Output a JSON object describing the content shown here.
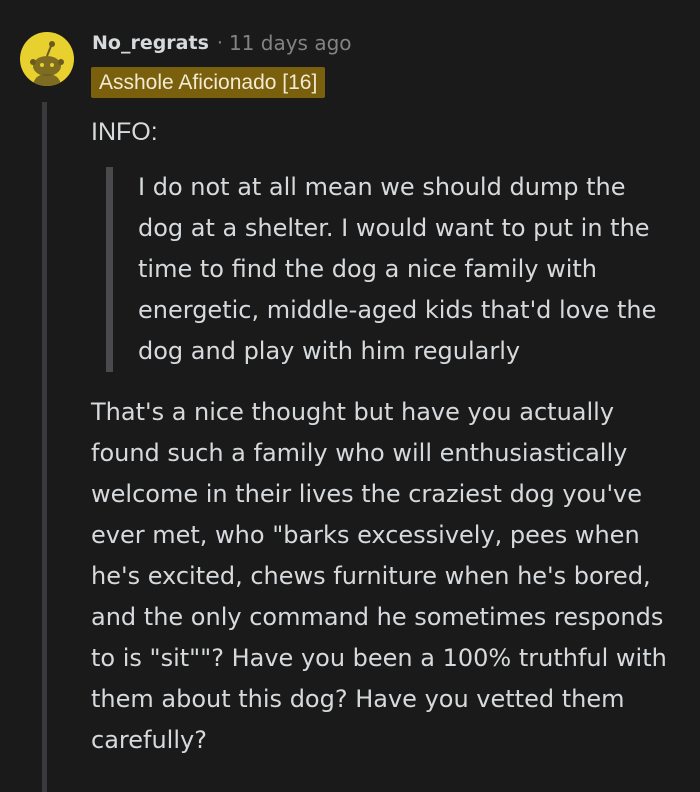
{
  "comment": {
    "author": "No_regrats",
    "separator": "·",
    "timestamp": "11 days ago",
    "flair": "Asshole Aficionado [16]",
    "info_label": "INFO:",
    "quote": "I do not at all mean we should dump the dog at a shelter. I would want to put in the time to find the dog a nice family with energetic, middle-aged kids that'd love the dog and play with him regularly",
    "reply": "That's a nice thought but have you actually found such a family who will enthusiastically welcome in their lives the craziest dog you've ever met, who \"barks excessively, pees when he's excited, chews furniture when he's bored, and the only command he sometimes responds to is \"sit\"\"? Have you been a 100% truthful with them about this dog? Have you vetted them carefully?"
  },
  "colors": {
    "background": "#1a1a1b",
    "text": "#d7dadc",
    "muted": "#818384",
    "flair_bg": "#7a5f0d",
    "avatar_bg": "#e8d12f"
  },
  "icons": {
    "avatar": "snoo-avatar-icon"
  }
}
